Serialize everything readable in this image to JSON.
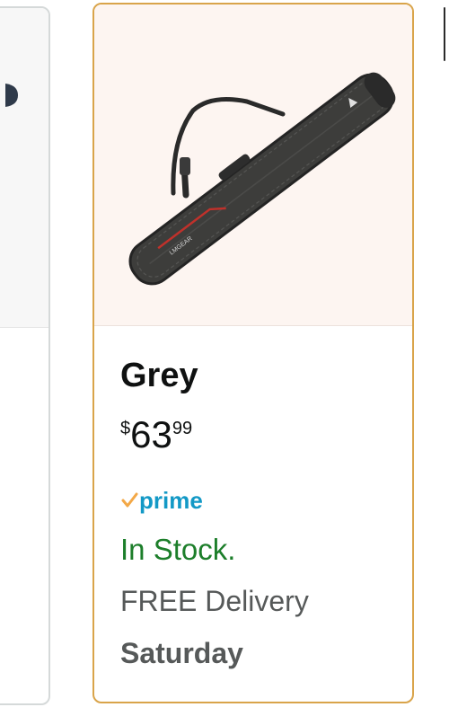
{
  "product": {
    "title": "Grey",
    "price": {
      "symbol": "$",
      "whole": "63",
      "fraction": "99"
    },
    "prime_label": "prime",
    "stock_status": "In Stock.",
    "delivery_label": "FREE Delivery",
    "delivery_day": "Saturday",
    "image_brand_text": "LMGEAR",
    "image_icon": "ski-bag-image"
  },
  "colors": {
    "selected_border": "#d9a44a",
    "price_text": "#0f1111",
    "prime_blue": "#1399c6",
    "prime_check": "#f3a847",
    "in_stock_green": "#1c7e2a",
    "secondary_text": "#565959"
  }
}
